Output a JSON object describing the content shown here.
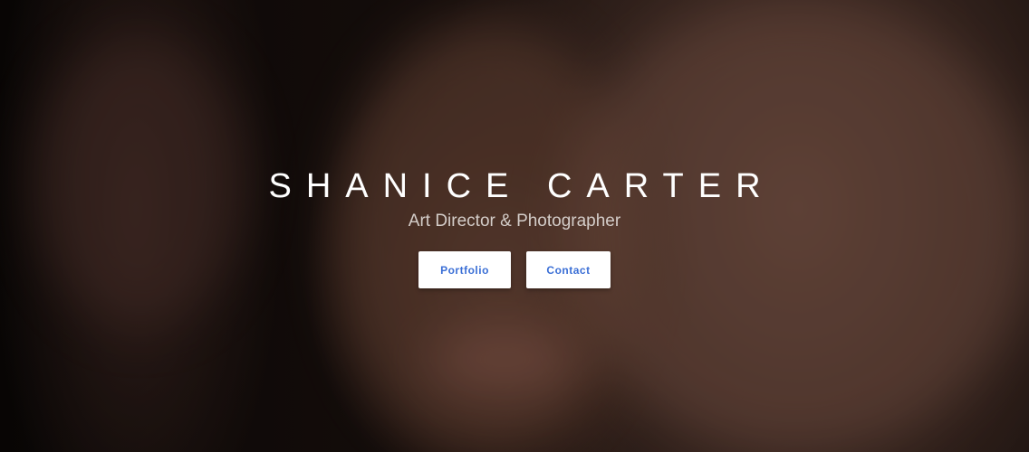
{
  "hero": {
    "name": "SHANICE CARTER",
    "subtitle": "Art Director & Photographer",
    "buttons": {
      "portfolio_label": "Portfolio",
      "contact_label": "Contact"
    }
  },
  "colors": {
    "button_text": "#3b6fd6",
    "button_bg": "#ffffff",
    "title_text": "#ffffff"
  }
}
